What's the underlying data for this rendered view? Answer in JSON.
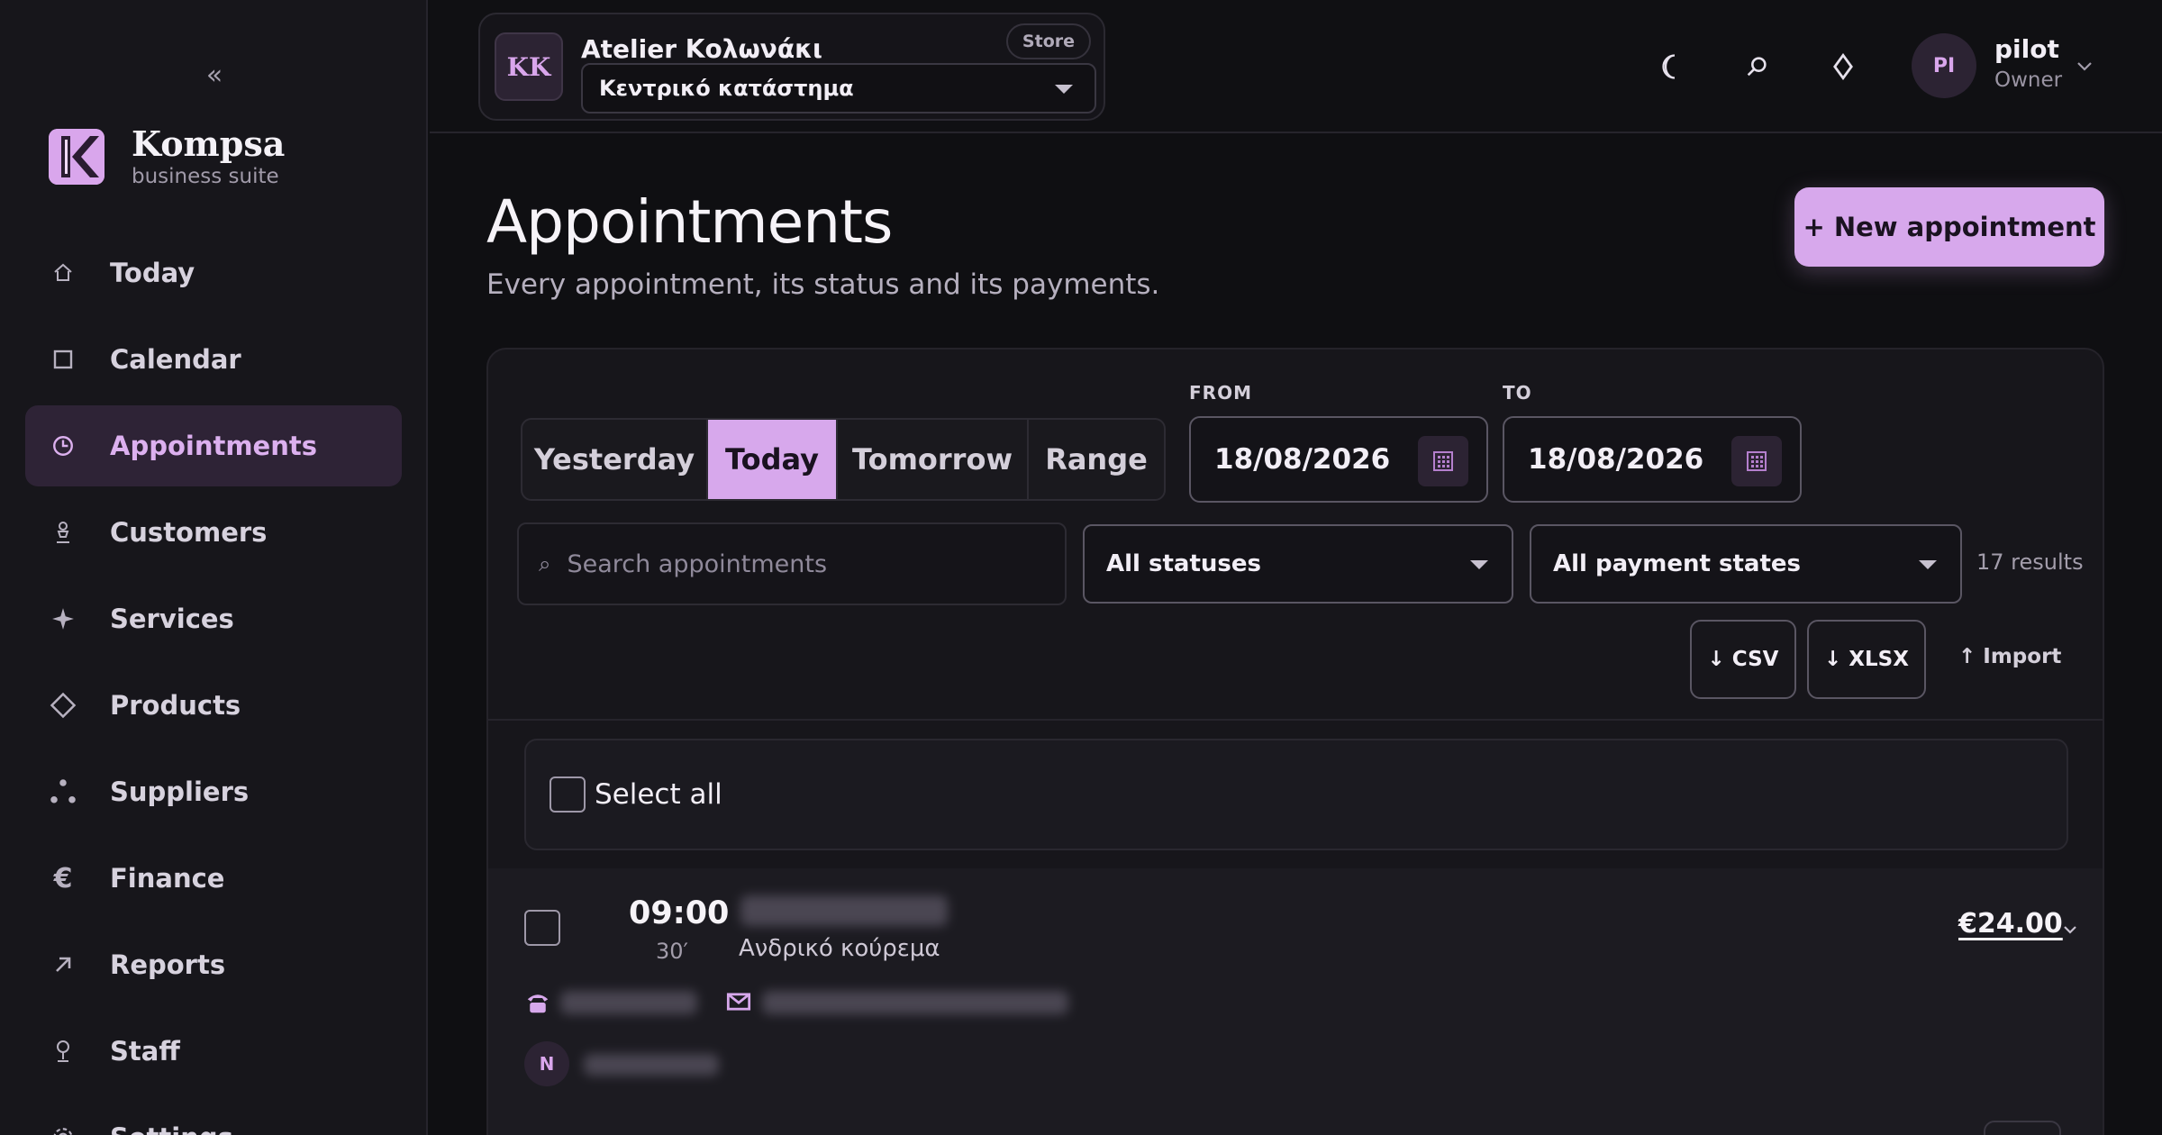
{
  "sidebar": {
    "collapse_glyph": "«",
    "brand": {
      "name": "Kompsa",
      "subtitle": "business suite"
    },
    "items": [
      {
        "label": "Today",
        "icon": "home-icon"
      },
      {
        "label": "Calendar",
        "icon": "calendar-icon"
      },
      {
        "label": "Appointments",
        "icon": "clock-icon",
        "active": true
      },
      {
        "label": "Customers",
        "icon": "person-icon"
      },
      {
        "label": "Services",
        "icon": "sparkle-icon"
      },
      {
        "label": "Products",
        "icon": "diamond-icon"
      },
      {
        "label": "Suppliers",
        "icon": "dots-icon"
      },
      {
        "label": "Finance",
        "icon": "euro-icon"
      },
      {
        "label": "Reports",
        "icon": "arrow-up-right-icon"
      },
      {
        "label": "Staff",
        "icon": "staff-icon"
      },
      {
        "label": "Settings",
        "icon": "gear-icon"
      }
    ]
  },
  "topbar": {
    "store": {
      "initials": "KK",
      "name": "Atelier Κολωνάκι",
      "badge": "Store",
      "location": "Κεντρικό κατάστημα"
    },
    "user": {
      "initials": "PI",
      "name": "pilot",
      "role": "Owner"
    }
  },
  "page": {
    "title": "Appointments",
    "subtitle": "Every appointment, its status and its payments.",
    "new_button": "+ New appointment"
  },
  "filters": {
    "tabs": [
      {
        "label": "Yesterday",
        "active": false
      },
      {
        "label": "Today",
        "active": true
      },
      {
        "label": "Tomorrow",
        "active": false
      },
      {
        "label": "Range",
        "active": false
      }
    ],
    "from_label": "FROM",
    "from_value": "18/08/2026",
    "to_label": "TO",
    "to_value": "18/08/2026",
    "search_placeholder": "Search appointments",
    "status_select": "All statuses",
    "payment_select": "All payment states",
    "results": "17 results",
    "csv_label": "↓ CSV",
    "xlsx_label": "↓ XLSX",
    "import_label": "↑ Import"
  },
  "list": {
    "select_all": "Select all",
    "appointments": [
      {
        "time": "09:00",
        "duration": "30′",
        "service": "Ανδρικό κούρεμα",
        "price": "€24.00",
        "staff_initial": "N"
      }
    ]
  },
  "colors": {
    "accent": "#d7a8ec",
    "background": "#0f0f12",
    "sidebar": "#17161b",
    "active_nav": "#2e2336"
  }
}
